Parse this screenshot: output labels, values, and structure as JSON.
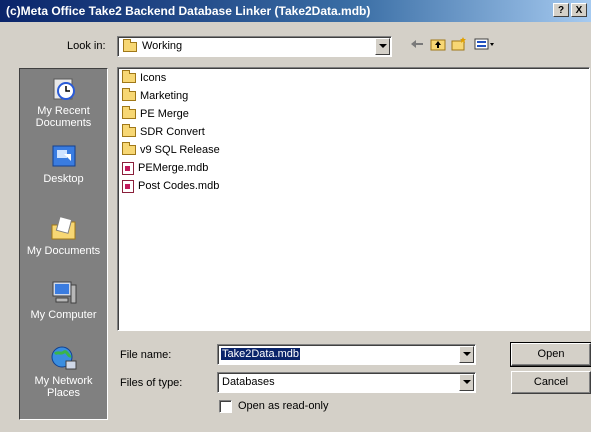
{
  "window": {
    "title": "(c)Meta Office Take2 Backend Database Linker (Take2Data.mdb)",
    "help_label": "?",
    "close_label": "X"
  },
  "lookin": {
    "label": "Look in:",
    "value": "Working"
  },
  "toolbar": {
    "back_icon": "back-arrow-icon",
    "up_icon": "up-folder-icon",
    "new_folder_icon": "new-folder-icon",
    "views_icon": "views-menu-icon"
  },
  "places": [
    {
      "label": "My Recent Documents",
      "icon": "recent-documents-icon"
    },
    {
      "label": "Desktop",
      "icon": "desktop-icon"
    },
    {
      "label": "My Documents",
      "icon": "my-documents-icon"
    },
    {
      "label": "My Computer",
      "icon": "my-computer-icon"
    },
    {
      "label": "My Network Places",
      "icon": "network-places-icon"
    }
  ],
  "files": [
    {
      "name": "Icons",
      "type": "folder"
    },
    {
      "name": "Marketing",
      "type": "folder"
    },
    {
      "name": "PE Merge",
      "type": "folder"
    },
    {
      "name": "SDR Convert",
      "type": "folder"
    },
    {
      "name": "v9 SQL Release",
      "type": "folder"
    },
    {
      "name": "PEMerge.mdb",
      "type": "mdb"
    },
    {
      "name": "Post Codes.mdb",
      "type": "mdb"
    }
  ],
  "filename": {
    "label": "File name:",
    "value": "Take2Data.mdb"
  },
  "filetype": {
    "label": "Files of type:",
    "value": "Databases"
  },
  "readonly": {
    "label": "Open as read-only",
    "checked": false
  },
  "buttons": {
    "open": "Open",
    "cancel": "Cancel"
  },
  "colors": {
    "title_bar": "#0a246a",
    "selection": "#0a246a",
    "dialog_bg": "#d4d0c8",
    "places_bg": "#808080"
  }
}
